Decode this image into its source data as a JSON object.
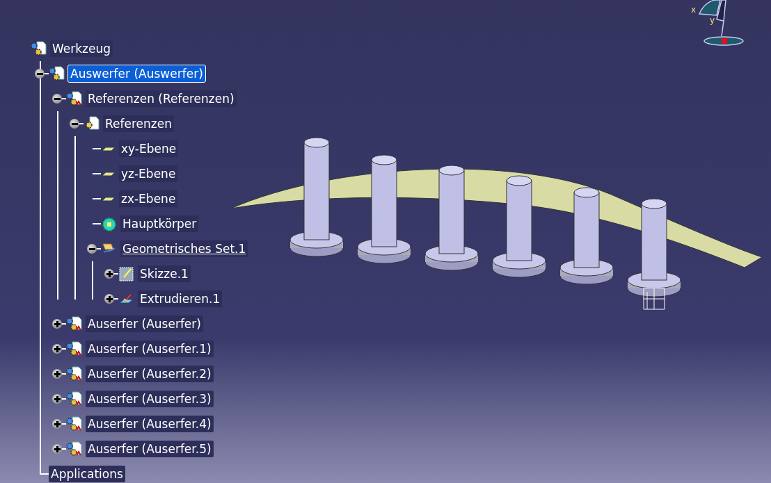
{
  "tree": {
    "label": "Werkzeug",
    "kind": "product",
    "selected": false,
    "current": false,
    "children": [
      {
        "label": "Auswerfer (Auswerfer)",
        "kind": "product",
        "expanded": true,
        "selected": true,
        "current": false,
        "children": [
          {
            "label": "Referenzen (Referenzen)",
            "kind": "component",
            "expanded": true,
            "selected": false,
            "current": false,
            "children": [
              {
                "label": "Referenzen",
                "kind": "part",
                "expanded": true,
                "selected": false,
                "current": false,
                "children": [
                  {
                    "label": "xy-Ebene",
                    "kind": "plane",
                    "selected": false,
                    "current": false
                  },
                  {
                    "label": "yz-Ebene",
                    "kind": "plane",
                    "selected": false,
                    "current": false
                  },
                  {
                    "label": "zx-Ebene",
                    "kind": "plane",
                    "selected": false,
                    "current": false
                  },
                  {
                    "label": "Hauptkörper",
                    "kind": "body",
                    "selected": false,
                    "current": false
                  },
                  {
                    "label": "Geometrisches Set.1",
                    "kind": "geoset",
                    "expanded": true,
                    "selected": false,
                    "current": true,
                    "children": [
                      {
                        "label": "Skizze.1",
                        "kind": "sketch",
                        "expanded": false,
                        "selected": false,
                        "current": false
                      },
                      {
                        "label": "Extrudieren.1",
                        "kind": "extrude",
                        "expanded": false,
                        "selected": false,
                        "current": false
                      }
                    ]
                  }
                ]
              }
            ]
          },
          {
            "label": "Auserfer (Auserfer)",
            "kind": "component",
            "expanded": false,
            "selected": false,
            "current": false
          },
          {
            "label": "Auserfer (Auserfer.1)",
            "kind": "component",
            "expanded": false,
            "selected": false,
            "current": false
          },
          {
            "label": "Auserfer (Auserfer.2)",
            "kind": "component",
            "expanded": false,
            "selected": false,
            "current": false
          },
          {
            "label": "Auserfer (Auserfer.3)",
            "kind": "component",
            "expanded": false,
            "selected": false,
            "current": false
          },
          {
            "label": "Auserfer (Auserfer.4)",
            "kind": "component",
            "expanded": false,
            "selected": false,
            "current": false
          },
          {
            "label": "Auserfer (Auserfer.5)",
            "kind": "component",
            "expanded": false,
            "selected": false,
            "current": false
          }
        ]
      },
      {
        "label": "Applications",
        "kind": "text",
        "selected": false,
        "current": false
      }
    ]
  },
  "compass": {
    "x_label": "x",
    "y_label": "y"
  }
}
